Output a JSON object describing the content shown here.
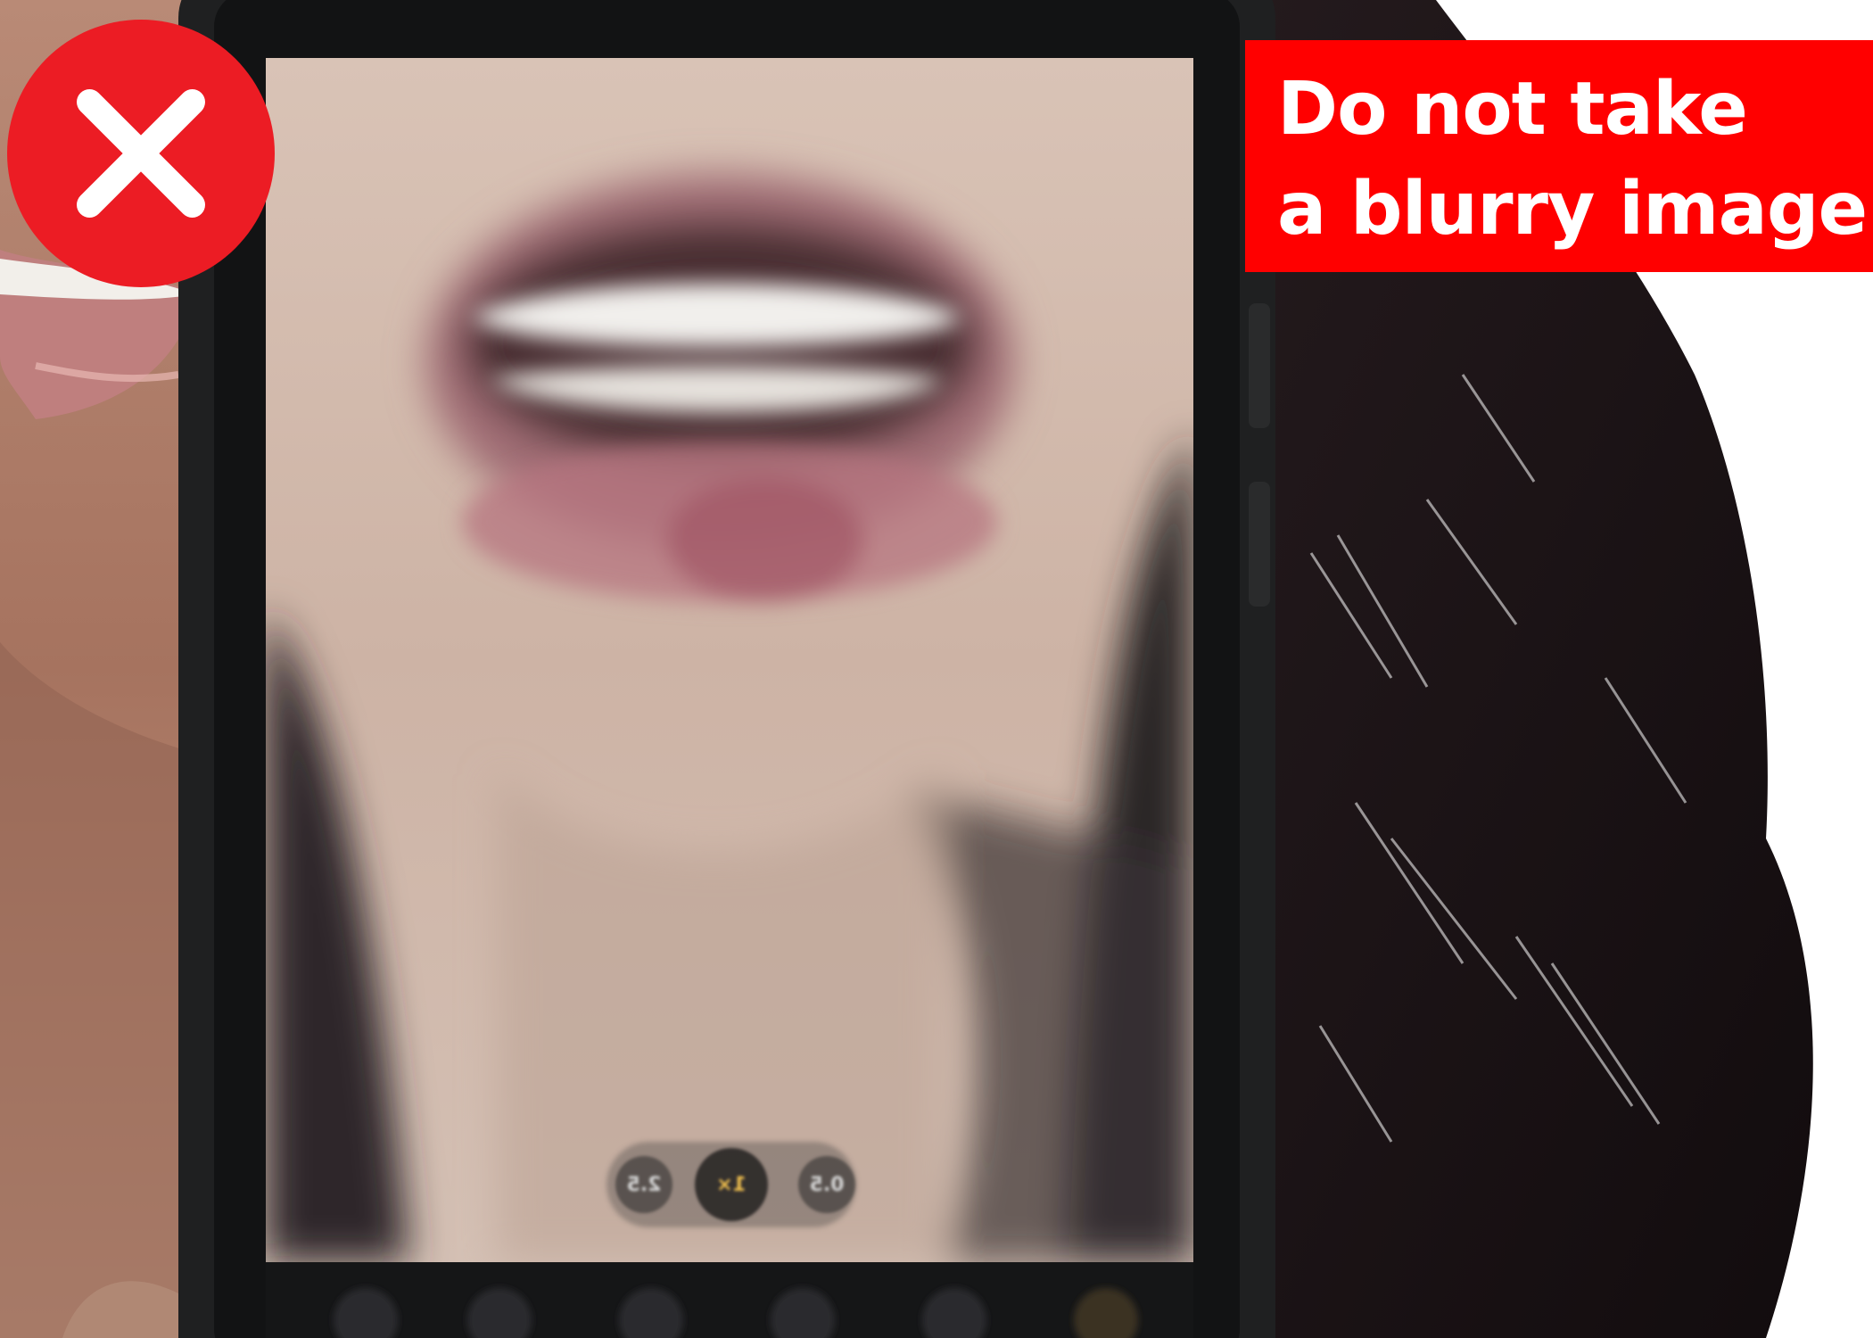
{
  "caption": {
    "line1": "Do not take",
    "line2": "a blurry image"
  },
  "badge": {
    "icon": "close-icon",
    "color": "#ec1c24"
  },
  "banner_color": "#ff0000",
  "camera_zoom": {
    "options": [
      "0.5",
      "1×",
      "2.5"
    ],
    "selected": "1×"
  }
}
